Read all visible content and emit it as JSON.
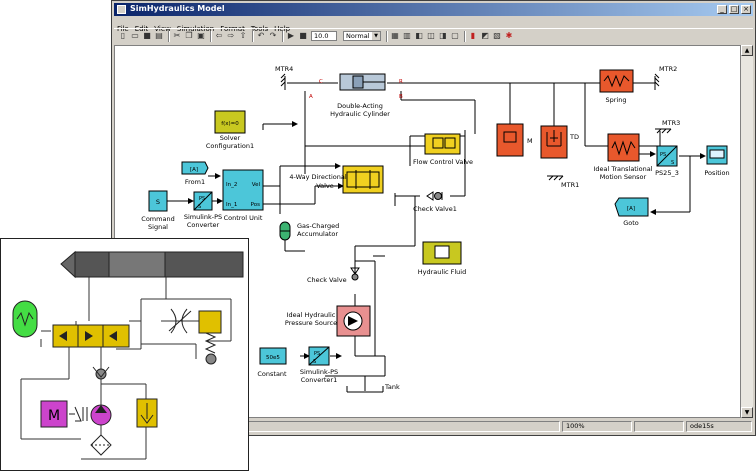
{
  "window": {
    "title": "SimHydraulics Model"
  },
  "menu": [
    "File",
    "Edit",
    "View",
    "Simulation",
    "Format",
    "Tools",
    "Help"
  ],
  "toolbar": {
    "stop_time": "10.0",
    "mode": "Normal"
  },
  "blocks": {
    "mtr4": "MTR4",
    "mtr2": "MTR2",
    "mtr3": "MTR3",
    "mtr1": "MTR1",
    "cylinder": {
      "line1": "Double-Acting",
      "line2": "Hydraulic Cylinder"
    },
    "port_a": "A",
    "port_b": "B",
    "port_c": "C",
    "port_r": "R",
    "spring": "Spring",
    "solver_icon": "f(x)=0",
    "solver": {
      "line1": "Solver",
      "line2": "Configuration1"
    },
    "mass": "M",
    "damper": "TD",
    "flow_control": "Flow Control Valve",
    "from_icon": "[A]",
    "from": "From1",
    "directional_valve": {
      "line1": "4-Way Directional",
      "line2": "Valve"
    },
    "sensor": {
      "line1": "Ideal Translational",
      "line2": "Motion Sensor"
    },
    "ps_s": "PS25_3",
    "position": "Position",
    "command": {
      "line1": "Command",
      "line2": "Signal"
    },
    "command_icon": "S",
    "sps": {
      "line1": "Simulink-PS",
      "line2": "Converter"
    },
    "control_unit": "Control Unit",
    "cu_ports": {
      "in2": "In_2",
      "in1": "In_1",
      "vel": "Vel",
      "pos": "Pos"
    },
    "check_valve1": "Check Valve1",
    "goto_icon": "[A]",
    "goto": "Goto",
    "accumulator": {
      "line1": "Gas-Charged",
      "line2": "Accumulator"
    },
    "hydraulic_fluid": "Hydraulic Fluid",
    "check_valve": "Check Valve",
    "pressure_source": {
      "line1": "Ideal Hydraulic",
      "line2": "Pressure Source"
    },
    "constant_icon": "50e5",
    "constant": "Constant",
    "sps1": {
      "line1": "Simulink-PS",
      "line2": "Converter1"
    },
    "tank": "Tank",
    "ps_label": "PS",
    "s_label": "S"
  },
  "status": {
    "zoom": "100%",
    "solver": "ode15s"
  },
  "inset": {
    "motor_label": "M"
  },
  "colors": {
    "hydraulic": "#f0d020",
    "mechanical": "#e8582c",
    "simulink": "#4cc6d9",
    "accumulator": "#3cb371"
  }
}
